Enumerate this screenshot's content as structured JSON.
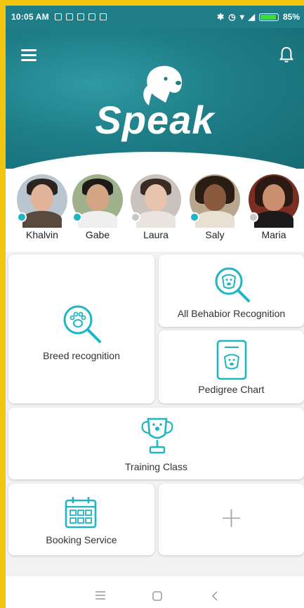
{
  "status_bar": {
    "time": "10:05 AM",
    "battery": "85%",
    "battery_level": 0.85,
    "left_icons": [
      "notification-icon",
      "facebook-icon",
      "linkedin-icon",
      "camera-icon",
      "bag-icon"
    ],
    "right_icons": [
      "bluetooth-icon",
      "alarm-icon",
      "wifi-icon",
      "signal-icon"
    ]
  },
  "header": {
    "brand": "Speak",
    "menu_icon": "hamburger-menu-icon",
    "notification_icon": "bell-icon",
    "color": "#1e7e88"
  },
  "contacts": [
    {
      "name": "Khalvin",
      "status": "online"
    },
    {
      "name": "Gabe",
      "status": "online"
    },
    {
      "name": "Laura",
      "status": "offline"
    },
    {
      "name": "Saly",
      "status": "online"
    },
    {
      "name": "Maria",
      "status": "offline"
    }
  ],
  "features": {
    "breed": {
      "label": "Breed recognition",
      "icon": "paw-search-icon"
    },
    "behavior": {
      "label": "All Behabior Recognition",
      "icon": "dog-search-icon"
    },
    "pedigree": {
      "label": "Pedigree Chart",
      "icon": "dog-certificate-icon"
    },
    "training": {
      "label": "Training Class",
      "icon": "trophy-icon"
    },
    "booking": {
      "label": "Booking Service",
      "icon": "calendar-icon"
    },
    "add": {
      "label": "+",
      "icon": "plus-icon"
    }
  },
  "navbar": {
    "icons": [
      "recents-icon",
      "home-icon",
      "back-icon"
    ]
  },
  "colors": {
    "accent": "#1fb5c2",
    "online": "#1fb5c2",
    "offline": "#c8c8c8",
    "frame": "#f1c40f"
  }
}
